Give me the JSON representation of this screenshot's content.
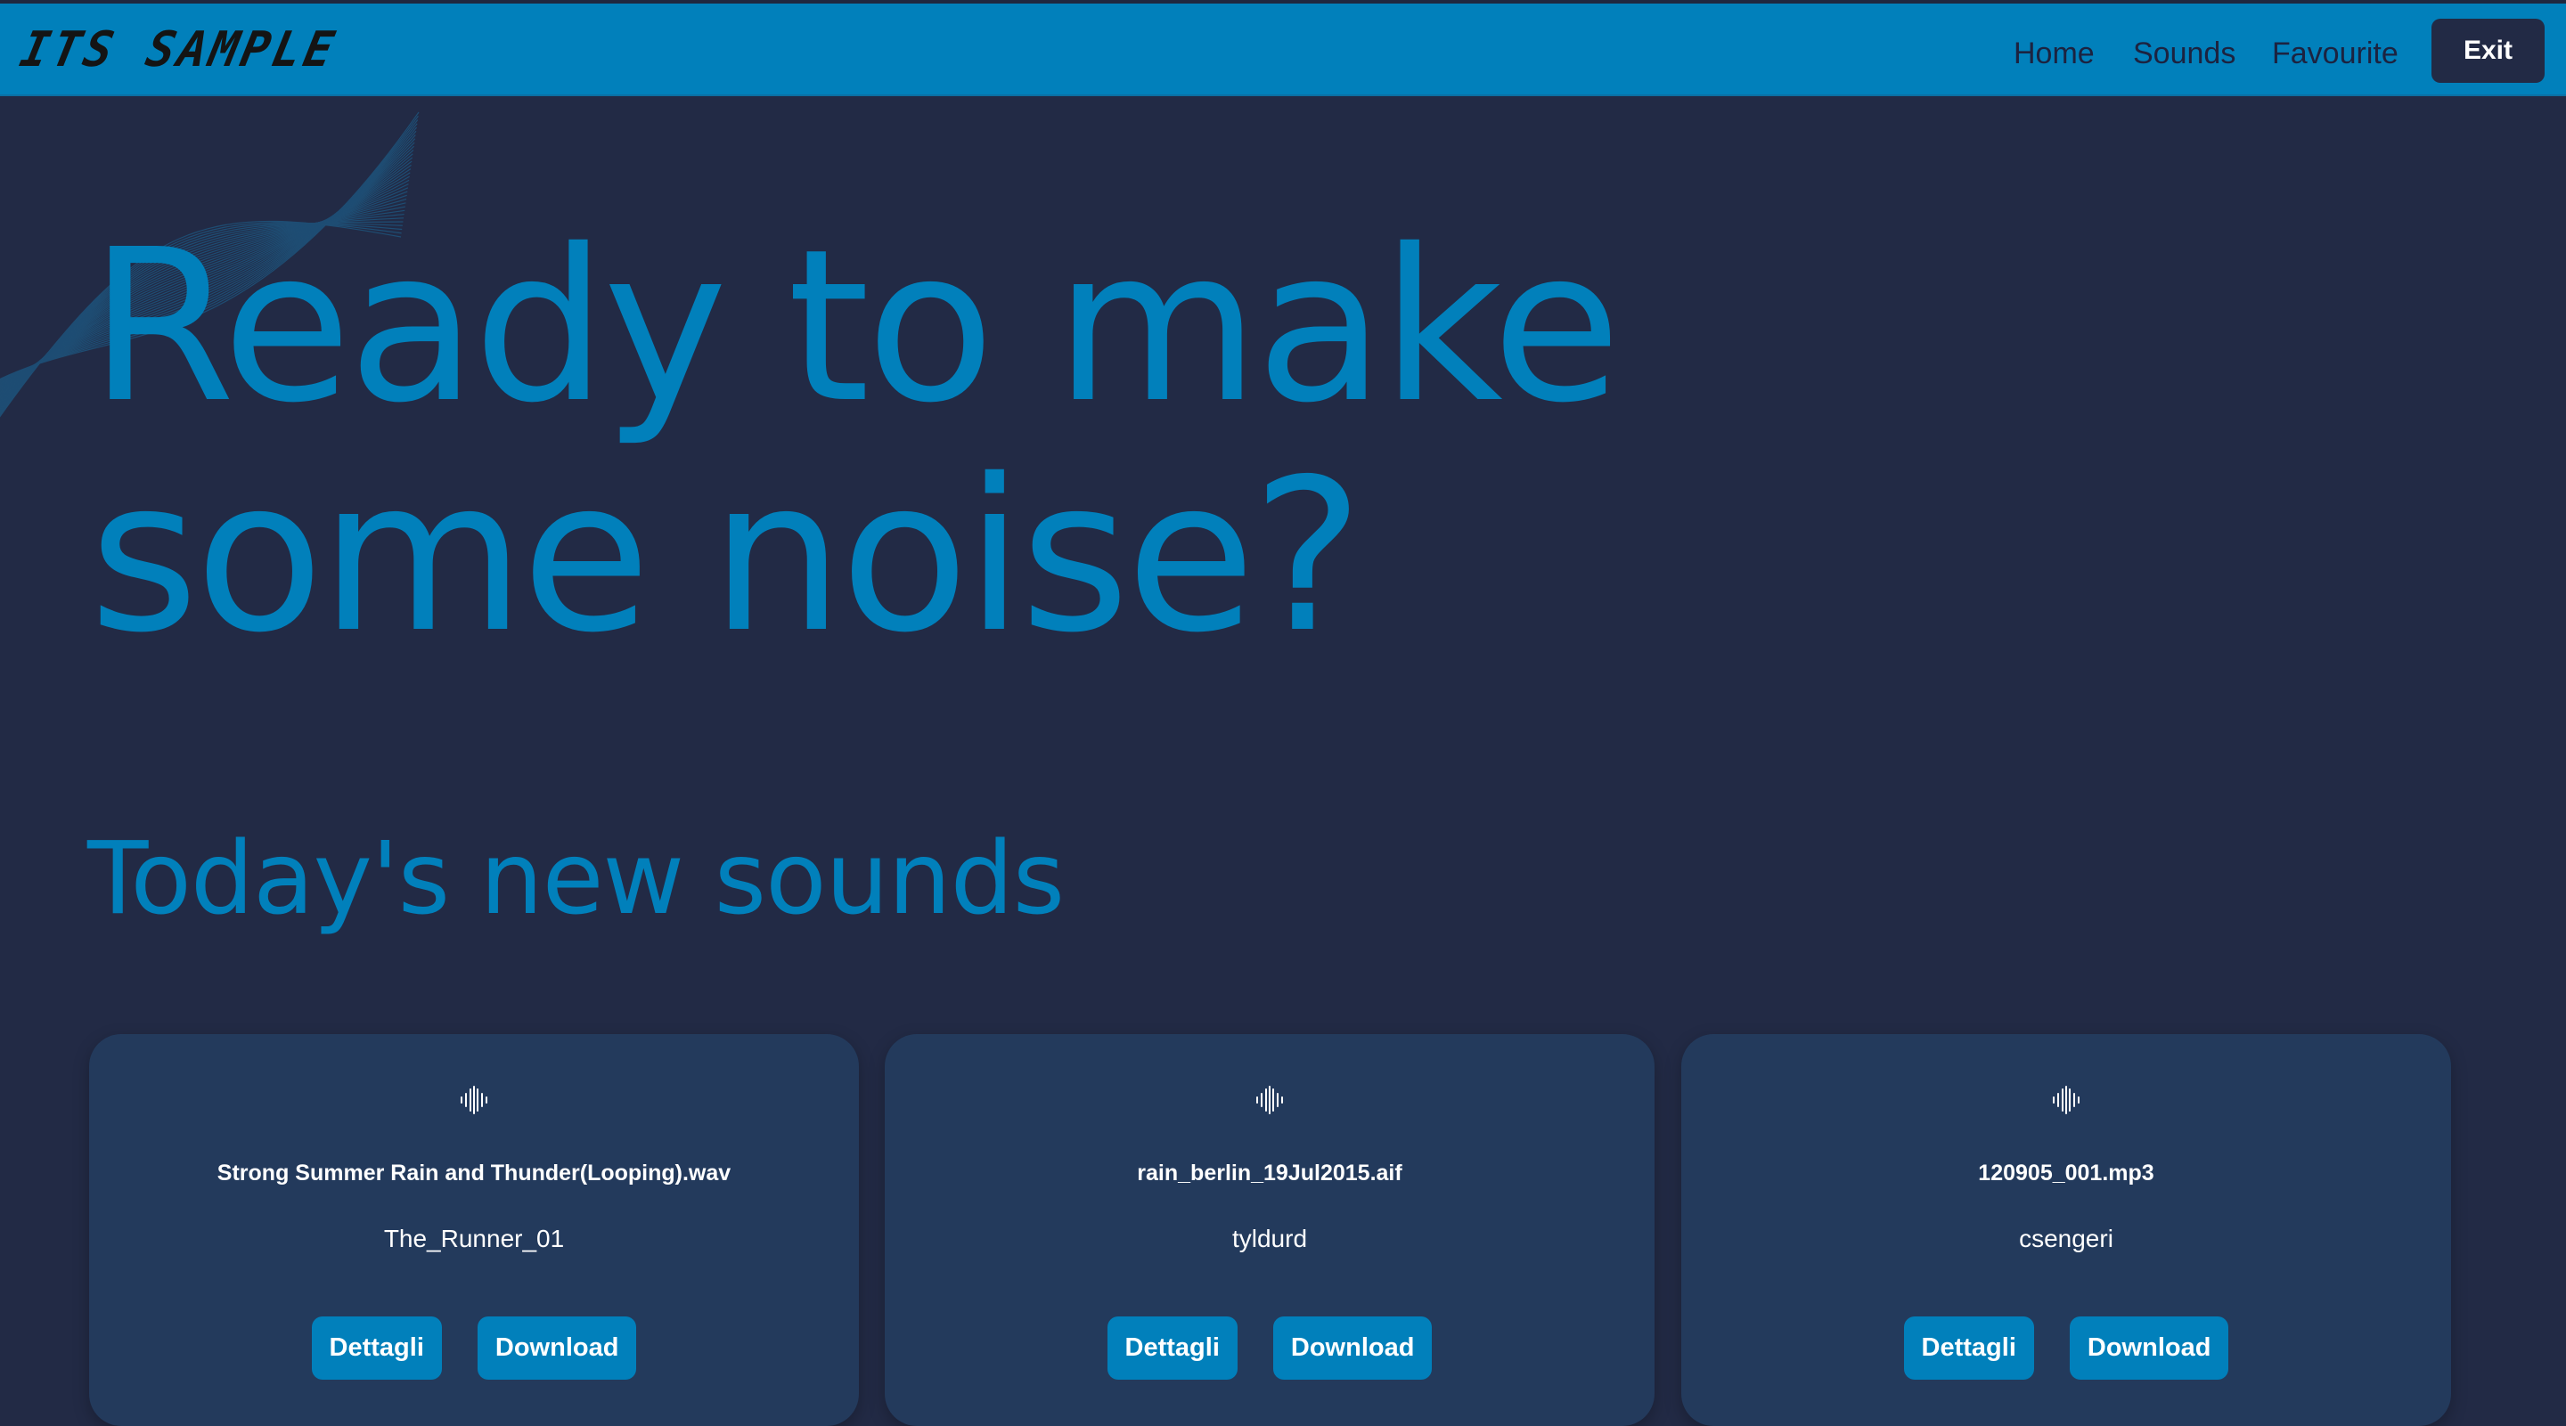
{
  "header": {
    "logo": "ITS SAMPLE",
    "nav": {
      "home": "Home",
      "sounds": "Sounds",
      "favourite": "Favourite"
    },
    "exit_label": "Exit"
  },
  "hero": {
    "title": "Ready to make\nsome noise?"
  },
  "section": {
    "title": "Today's new sounds"
  },
  "cards": [
    {
      "icon": "waveform-icon",
      "name": "Strong Summer Rain and Thunder(Looping).wav",
      "author": "The_Runner_01",
      "details_label": "Dettagli",
      "download_label": "Download"
    },
    {
      "icon": "waveform-icon",
      "name": "rain_berlin_19Jul2015.aif",
      "author": "tyldurd",
      "details_label": "Dettagli",
      "download_label": "Download"
    },
    {
      "icon": "waveform-icon",
      "name": "120905_001.mp3",
      "author": "csengeri",
      "details_label": "Dettagli",
      "download_label": "Download"
    }
  ],
  "colors": {
    "background": "#222a45",
    "navbar": "#0180bb",
    "accent": "#0180bb",
    "card": "#233a5c",
    "nav_text": "#1c2340"
  }
}
